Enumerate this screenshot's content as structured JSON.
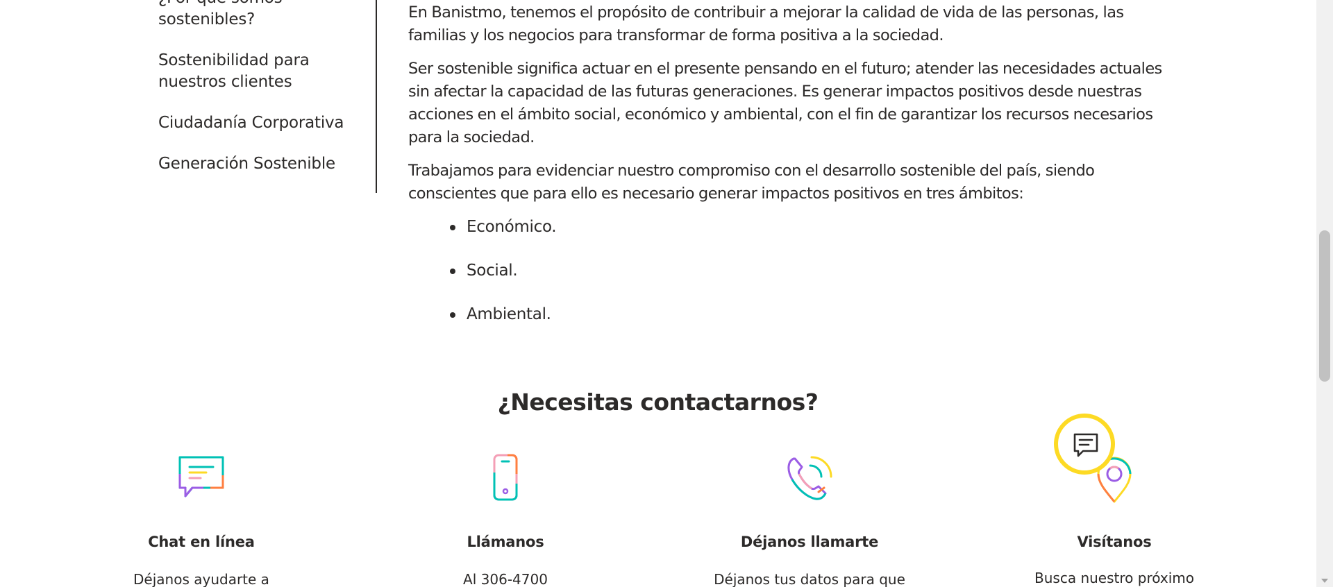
{
  "sidebar": {
    "items": [
      {
        "label": "¿Por qué somos sostenibles?"
      },
      {
        "label": "Sostenibilidad para nuestros clientes"
      },
      {
        "label": "Ciudadanía Corporativa"
      },
      {
        "label": "Generación Sostenible"
      }
    ]
  },
  "content": {
    "paragraphs": [
      "En Banistmo, tenemos el propósito de contribuir a mejorar la calidad de vida de las personas, las familias y los negocios para transformar de forma positiva a la sociedad.",
      "Ser sostenible significa actuar en el presente pensando en el futuro; atender las necesidades actuales sin afectar la capacidad de las futuras generaciones. Es generar impactos positivos desde nuestras acciones en el ámbito social, económico y ambiental, con el fin de garantizar los recursos necesarios para la sociedad.",
      "Trabajamos para evidenciar nuestro compromiso con el desarrollo sostenible del país, siendo conscientes que para ello es necesario generar impactos positivos en tres ámbitos:"
    ],
    "bullets": [
      "Económico.",
      "Social.",
      "Ambiental."
    ]
  },
  "contact": {
    "title": "¿Necesitas contactarnos?",
    "cards": [
      {
        "icon": "chat-bubble-icon",
        "title": "Chat en línea",
        "desc": "Déjanos ayudarte a"
      },
      {
        "icon": "mobile-phone-icon",
        "title": "Llámanos",
        "desc": "Al 306-4700"
      },
      {
        "icon": "phone-call-icon",
        "title": "Déjanos llamarte",
        "desc": "Déjanos tus datos para que"
      },
      {
        "icon": "location-pin-icon",
        "title": "Visítanos",
        "desc": "Busca nuestro próximo"
      }
    ]
  },
  "colors": {
    "text": "#2c2a29",
    "accent_yellow": "#fdda24",
    "icon_teal": "#00c1b5",
    "icon_purple": "#9b5de5",
    "icon_orange": "#ff7f41",
    "icon_pink": "#f49fb6"
  }
}
